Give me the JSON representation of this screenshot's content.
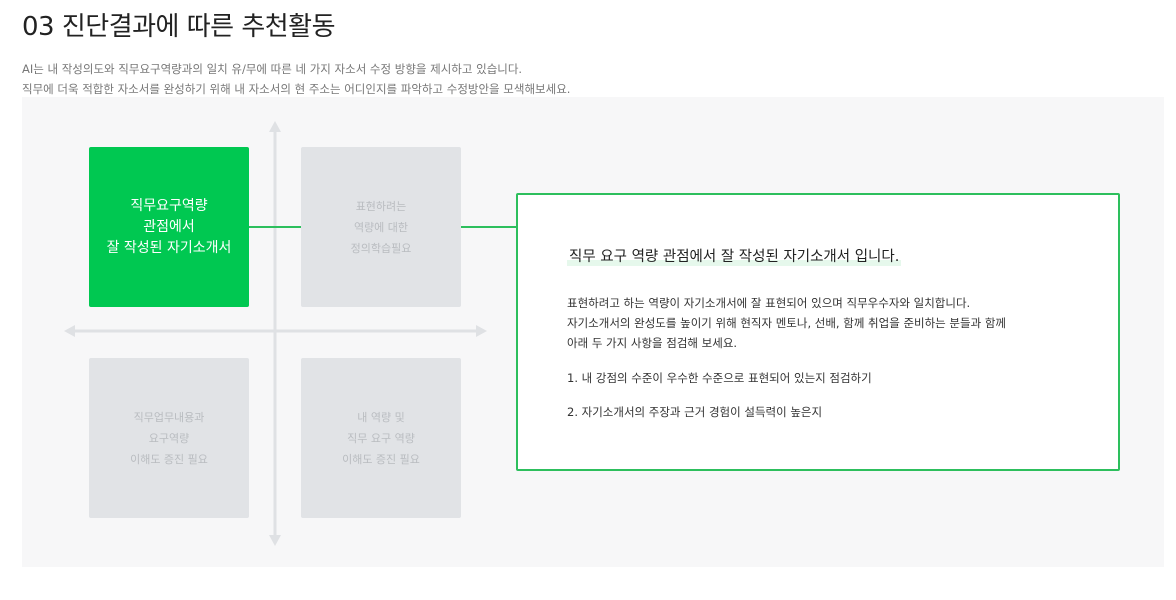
{
  "header": {
    "title": "03 진단결과에 따른 추천활동",
    "desc_line1": "AI는 내 작성의도와 직무요구역량과의 일치 유/무에 따른 네 가지 자소서 수정 방향을 제시하고 있습니다.",
    "desc_line2": "직무에 더욱 적합한 자소서를 완성하기 위해 내 자소서의 현 주소는 어디인지를 파악하고 수정방안을 모색해보세요."
  },
  "quadrants": {
    "q1": {
      "lines": [
        "직무요구역량",
        "관점에서",
        "잘 작성된 자기소개서"
      ],
      "active": true
    },
    "q2": {
      "lines": [
        "표현하려는",
        "역량에 대한",
        "정의학습필요"
      ],
      "active": false
    },
    "q3": {
      "lines": [
        "직무업무내용과",
        "요구역량",
        "이해도 증진 필요"
      ],
      "active": false
    },
    "q4": {
      "lines": [
        "내 역량 및",
        "직무 요구 역량",
        "이해도 증진 필요"
      ],
      "active": false
    }
  },
  "detail": {
    "title": "직무 요구 역량 관점에서 잘 작성된 자기소개서 입니다.",
    "body": [
      "표현하려고 하는 역량이 자기소개서에 잘 표현되어 있으며 직무우수자와 일치합니다.",
      "자기소개서의 완성도를 높이기 위해 현직자 멘토나, 선배, 함께 취업을 준비하는 분들과 함께",
      "아래 두 가지 사항을 점검해 보세요."
    ],
    "items": [
      "1. 내 강점의 수준이 우수한 수준으로 표현되어 있는지 점검하기",
      "2. 자기소개서의 주장과 근거 경험이 설득력이 높은지"
    ]
  },
  "colors": {
    "accent": "#00c851",
    "accent_border": "#2dbf5d",
    "inactive_box": "#e1e3e6",
    "inactive_text": "#b9bcc0",
    "panel_bg": "#f7f7f8",
    "axis": "#dfe1e4"
  },
  "icons": {
    "axis_arrows": "arrow-head-icon"
  }
}
